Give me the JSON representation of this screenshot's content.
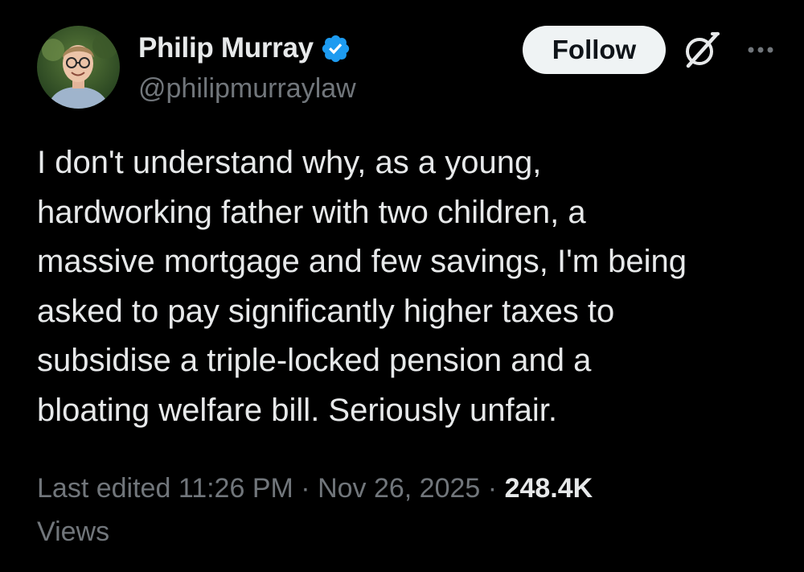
{
  "author": {
    "display_name": "Philip Murray",
    "handle": "@philipmurraylaw",
    "verified": true,
    "verified_color": "#1d9bf0"
  },
  "actions": {
    "follow_label": "Follow",
    "grok_icon": "grok-icon",
    "more_icon": "more-icon"
  },
  "tweet": {
    "text_lines": [
      "I don't understand why, as a young,",
      "hardworking father with two children, a",
      "massive mortgage and few savings, I'm being",
      "asked to pay significantly higher taxes to",
      "subsidise a triple-locked pension and a",
      "bloating welfare bill. Seriously unfair."
    ]
  },
  "meta": {
    "edited_label": "Last edited",
    "time": "11:26 PM",
    "separator": "·",
    "date": "Nov 26, 2025",
    "views_count": "248.4K",
    "views_label": "Views"
  },
  "colors": {
    "background": "#000000",
    "primary_text": "#e7e9ea",
    "secondary_text": "#71767b",
    "follow_bg": "#eff3f4"
  }
}
